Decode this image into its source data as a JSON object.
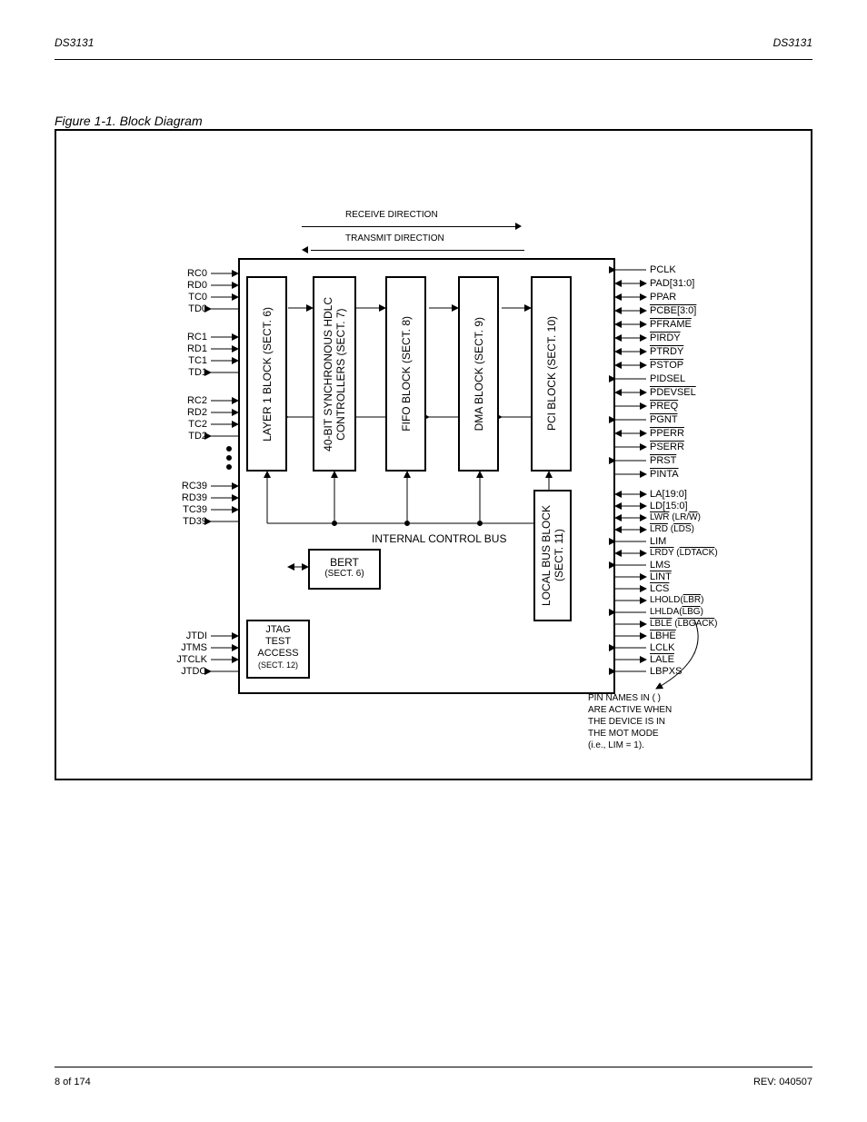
{
  "header": {
    "left": "DS3131",
    "right": "DS3131"
  },
  "figure_title": "Figure 1-1. Block Diagram",
  "directions": {
    "receive": "RECEIVE DIRECTION",
    "transmit": "TRANSMIT DIRECTION"
  },
  "blocks": {
    "layer1": "LAYER 1 BLOCK (SECT. 6)",
    "hdlc1": "40-BIT SYNCHRONOUS HDLC",
    "hdlc2": "CONTROLLERS (SECT. 7)",
    "fifo": "FIFO BLOCK (SECT. 8)",
    "dma": "DMA BLOCK (SECT. 9)",
    "pci": "PCI BLOCK (SECT. 10)",
    "localbus1": "LOCAL BUS BLOCK",
    "localbus2": "(SECT. 11)",
    "bert": "BERT",
    "bert_sect": "(SECT. 6)",
    "jtag1": "JTAG",
    "jtag2": "TEST",
    "jtag3": "ACCESS",
    "jtag_sect": "(SECT. 12)",
    "control_bus": "INTERNAL CONTROL BUS"
  },
  "pins_left": {
    "p0": [
      "RC0",
      "RD0",
      "TC0",
      "TD0"
    ],
    "p1": [
      "RC1",
      "RD1",
      "TC1",
      "TD1"
    ],
    "p2": [
      "RC2",
      "RD2",
      "TC2",
      "TD2"
    ],
    "p39": [
      "RC39",
      "RD39",
      "TC39",
      "TD39"
    ],
    "jtag": [
      "JTDI",
      "JTMS",
      "JTCLK",
      "JTDO"
    ]
  },
  "pins_right": {
    "pclk": "PCLK",
    "pad": "PAD[31:0]",
    "ppar": "PPAR",
    "pcbe": "PCBE[3:0]",
    "pframe": "PFRAME",
    "pirdy": "PIRDY",
    "ptrdy": "PTRDY",
    "pstop": "PSTOP",
    "pidsel": "PIDSEL",
    "pdevsel": "PDEVSEL",
    "preq": "PREQ",
    "pgnt": "PGNT",
    "pperr": "PPERR",
    "pserr": "PSERR",
    "prst": "PRST",
    "pinta": "PINTA",
    "la": "LA[19:0]",
    "ld": "LD[15:0]",
    "lwr_lrw": "LWR (LR/W)",
    "lrd_lds": "LRD (LDS)",
    "lim": "LIM",
    "lrdy_ldtack": "LRDY (LDTACK)",
    "lms": "LMS",
    "lint": "LINT",
    "lcs": "LCS",
    "lhold": "LHOLD(LBR)",
    "lhlda": "LHLDA(LBG)",
    "lble_lbgack": "LBLE (LBGACK)",
    "lbhe": "LBHE",
    "lclk": "LCLK",
    "lale": "LALE",
    "lbpxs": "LBPXS"
  },
  "note": [
    "PIN NAMES IN ( )",
    "ARE ACTIVE WHEN",
    "THE DEVICE IS IN",
    "THE MOT MODE",
    "(i.e., LIM = 1)."
  ],
  "footer": {
    "left": "8 of 174",
    "right": "REV: 040507"
  }
}
